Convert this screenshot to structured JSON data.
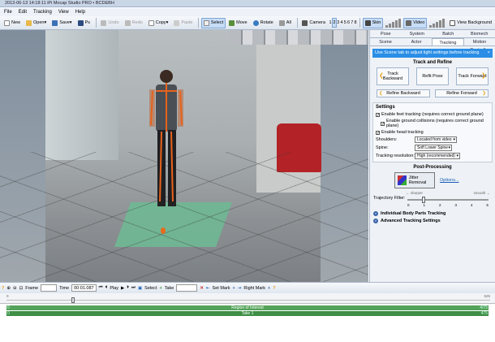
{
  "window": {
    "title": "2013-06-13 14:18:11 iPi Mocap Studio PRO • BCDEBH"
  },
  "menu": [
    "File",
    "Edit",
    "Tracking",
    "View",
    "Help"
  ],
  "toolbar": {
    "new": "New",
    "open": "Open",
    "save": "Save",
    "ps": "Ps",
    "undo": "Undo",
    "redo": "Redo",
    "copy": "Copy",
    "paste": "Paste",
    "select": "Select",
    "move": "Move",
    "rotate": "Rotate",
    "all": "All",
    "camera": "Camera",
    "cameras": [
      "1",
      "2",
      "3",
      "4",
      "5",
      "6",
      "7",
      "8"
    ],
    "active_camera": "2",
    "skin": "Skin",
    "video": "Video",
    "view_background": "View Background"
  },
  "panel": {
    "tabs_top": [
      "Pose",
      "System",
      "Batch",
      "Biomech"
    ],
    "tabs_bottom": [
      "Scene",
      "Actor",
      "Tracking",
      "Motion Controller"
    ],
    "active_tab": "Tracking",
    "info_text": "Use Scene tab to adjust light settings before tracking",
    "info_close": "×",
    "track_refine": {
      "title": "Track and Refine",
      "track_backward": "Track Backward",
      "refit_pose": "Refit Pose",
      "track_forward": "Track Forward",
      "refine_backward": "Refine Backward",
      "refine_forward": "Refine Forward"
    },
    "settings": {
      "title": "Settings",
      "opt1": "Enable feet tracking (requires correct ground plane)",
      "opt2": "Enable ground collisions (requires correct ground plane)",
      "opt3": "Enable head tracking",
      "shoulders_label": "Shoulders:",
      "shoulders_value": "Located from video",
      "spine_label": "Spine:",
      "spine_value": "Soft Lower Spine",
      "res_label": "Tracking resolution:",
      "res_value": "High (recommended)"
    },
    "post": {
      "title": "Post-Processing",
      "filter_btn": "Jitter Removal",
      "options_link": "Options...",
      "slider_label": "Trajectory Filter:",
      "left_end": "← sharper",
      "right_end": "smooth →",
      "ticks": [
        "0",
        "1",
        "2",
        "3",
        "4",
        "5"
      ],
      "value": 1
    },
    "expanders": [
      "Individual Body Parts Tracking",
      "Advanced Tracking Settings"
    ]
  },
  "timeline": {
    "frame_label": "Frame",
    "time_label": "Time",
    "time_value": "00:01.087",
    "play": "Play",
    "select": "Select",
    "take": "Take",
    "set_mark": "Set Mark",
    "right_mark": "Right Mark"
  },
  "ruler": {
    "left": "0",
    "right": "525"
  },
  "roi": {
    "label": "Region of Interest",
    "left": "0",
    "right": "4/75"
  },
  "take": {
    "label": "Take 1",
    "left": "0",
    "right": "475"
  }
}
